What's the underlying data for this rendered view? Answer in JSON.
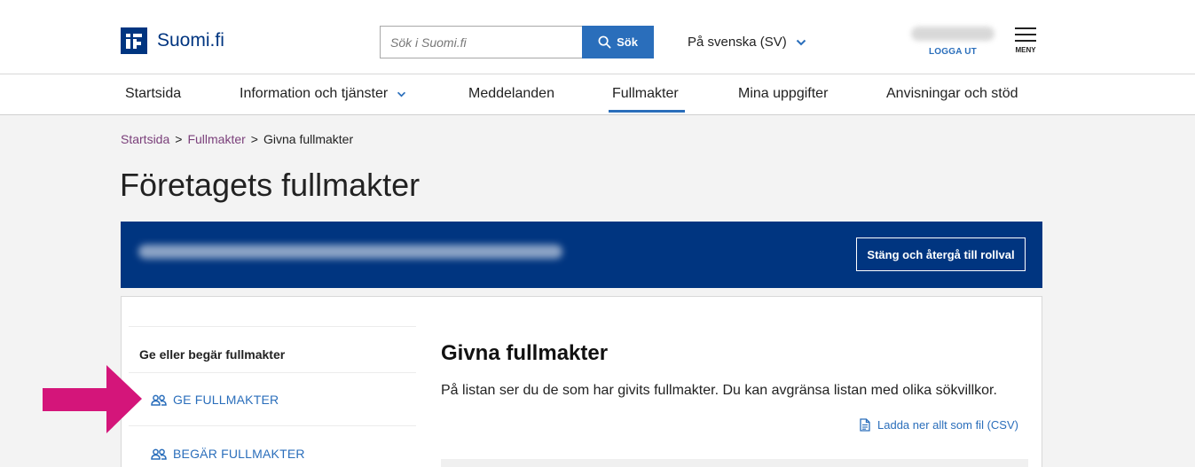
{
  "header": {
    "logo_text": "Suomi.fi",
    "search": {
      "placeholder": "Sök i Suomi.fi",
      "button_label": "Sök"
    },
    "language": "På svenska (SV)",
    "logout_label": "LOGGA UT",
    "menu_label": "MENY"
  },
  "nav": {
    "items": [
      {
        "label": "Startsida"
      },
      {
        "label": "Information och tjänster"
      },
      {
        "label": "Meddelanden"
      },
      {
        "label": "Fullmakter",
        "active": true
      },
      {
        "label": "Mina uppgifter"
      },
      {
        "label": "Anvisningar och stöd"
      }
    ]
  },
  "breadcrumb": {
    "items": [
      "Startsida",
      "Fullmakter",
      "Givna fullmakter"
    ],
    "separator": ">"
  },
  "page_title": "Företagets fullmakter",
  "banner": {
    "button_label": "Stäng och återgå till rollval"
  },
  "sidebar": {
    "heading": "Ge eller begär fullmakter",
    "links": [
      {
        "label": "GE FULLMAKTER",
        "icon": "users-icon"
      },
      {
        "label": "BEGÄR FULLMAKTER",
        "icon": "users-icon"
      }
    ]
  },
  "main": {
    "title": "Givna fullmakter",
    "description": "På listan ser du de som har givits fullmakter. Du kan avgränsa listan med olika sökvillkor.",
    "download_label": "Ladda ner allt som fil (CSV)"
  },
  "colors": {
    "brand": "#003580",
    "accent": "#2a6ebb",
    "breadcrumb_link": "#7a3f7a",
    "annotation_arrow": "#d4157a"
  }
}
